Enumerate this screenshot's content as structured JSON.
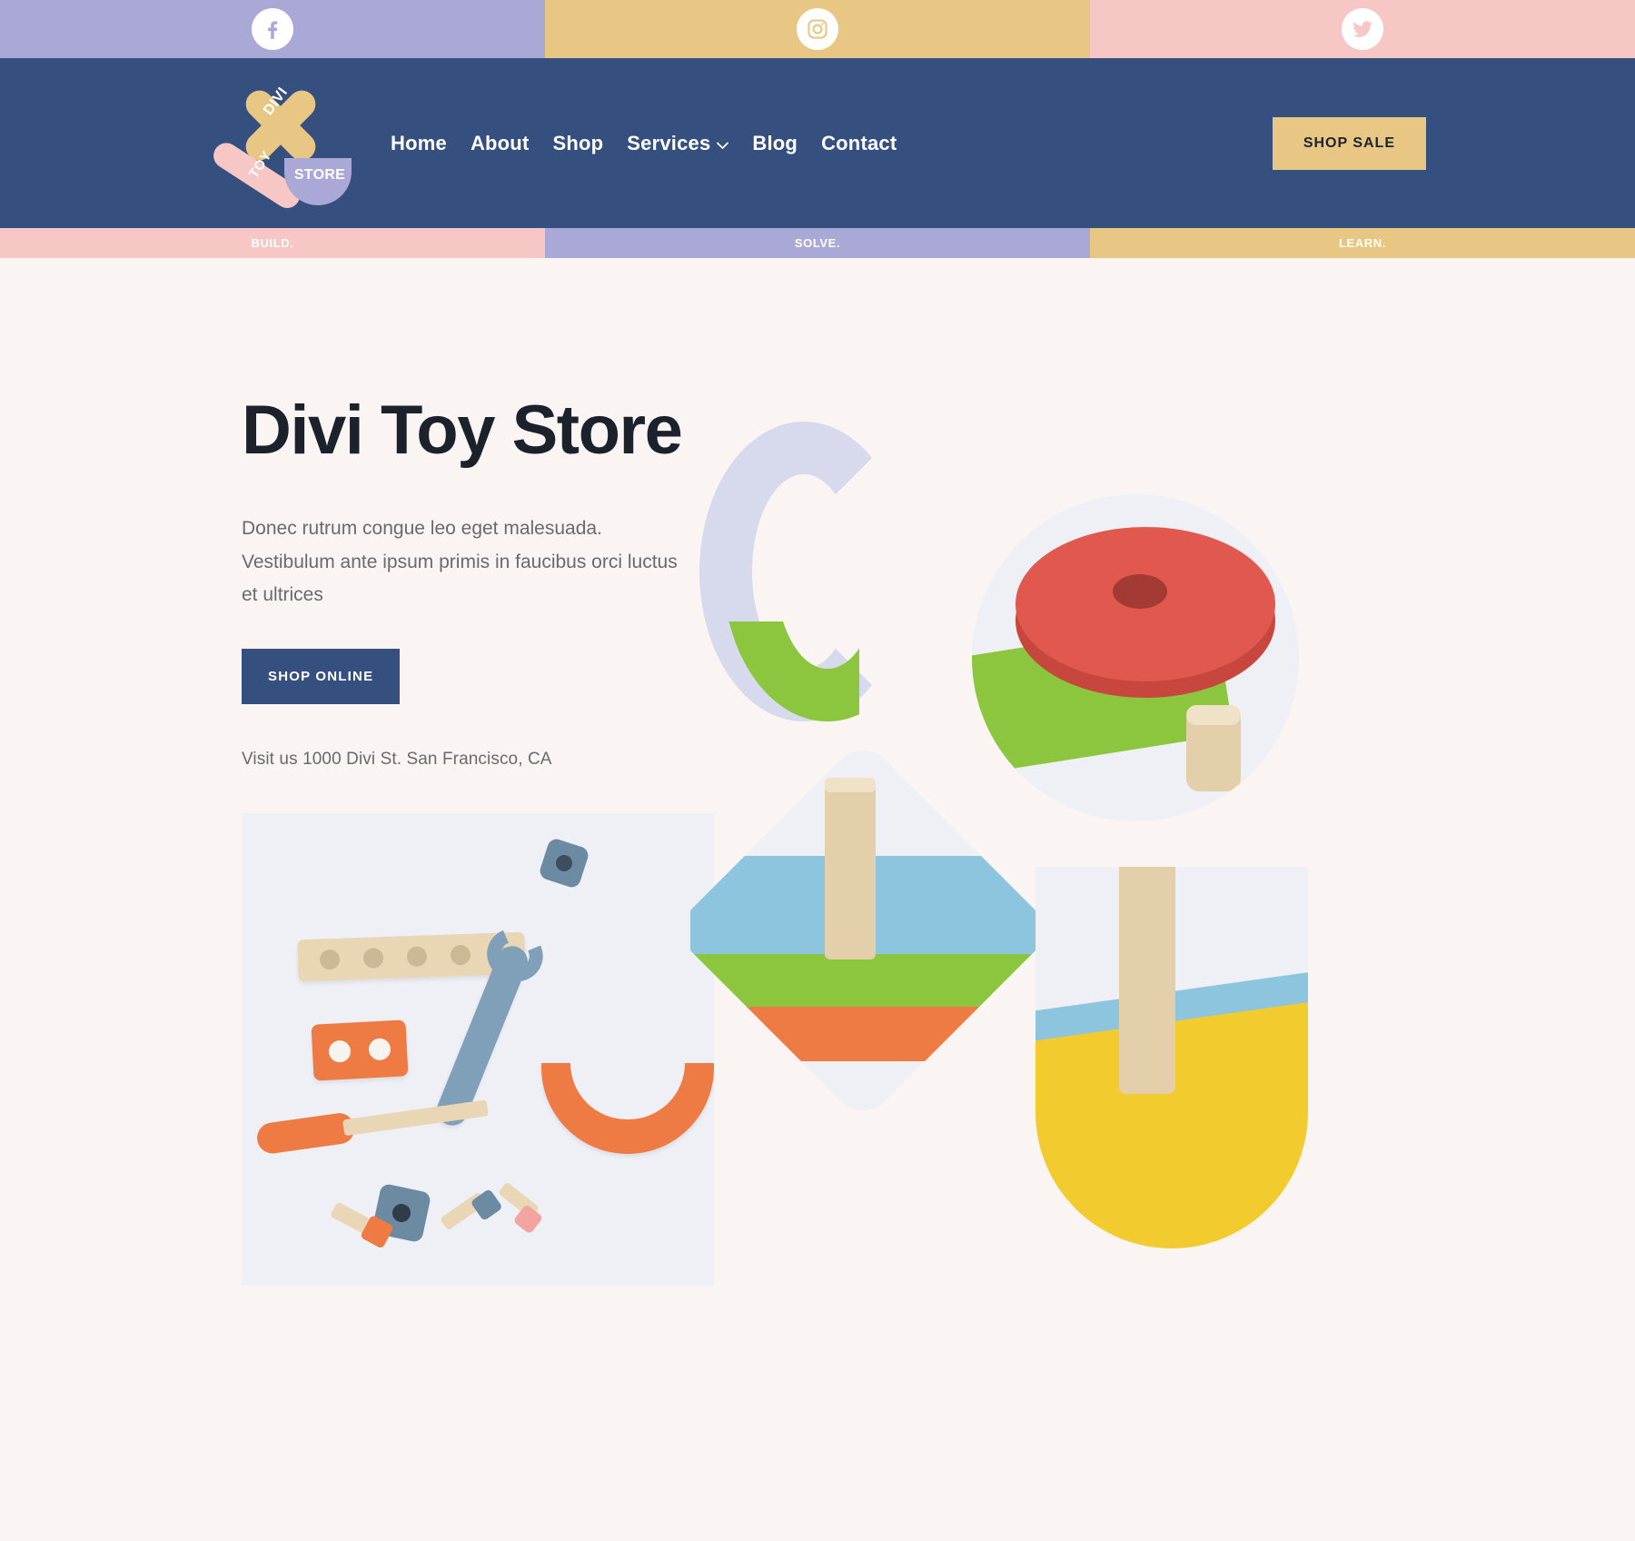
{
  "social_bar": {
    "items": [
      {
        "name": "facebook",
        "icon": "facebook-icon",
        "bg": "#a9a8d6",
        "glyph_color": "#a9a8d6"
      },
      {
        "name": "instagram",
        "icon": "instagram-icon",
        "bg": "#e8c683",
        "glyph_color": "#e8c683"
      },
      {
        "name": "twitter",
        "icon": "twitter-icon",
        "bg": "#f6c7c4",
        "glyph_color": "#f6c7c4"
      }
    ]
  },
  "navbar": {
    "bg": "#35507f",
    "logo": {
      "divi": "DIVI",
      "toy": "TOY",
      "store": "STORE"
    },
    "menu": [
      {
        "label": "Home",
        "has_dropdown": false
      },
      {
        "label": "About",
        "has_dropdown": false
      },
      {
        "label": "Shop",
        "has_dropdown": false
      },
      {
        "label": "Services",
        "has_dropdown": true
      },
      {
        "label": "Blog",
        "has_dropdown": false
      },
      {
        "label": "Contact",
        "has_dropdown": false
      }
    ],
    "cta": {
      "label": "SHOP SALE",
      "bg": "#e8c683",
      "color": "#1c2430"
    }
  },
  "strap": {
    "cells": [
      {
        "label": "BUILD.",
        "bg": "#f6c7c4"
      },
      {
        "label": "SOLVE.",
        "bg": "#a9a8d6"
      },
      {
        "label": "LEARN.",
        "bg": "#e8c683"
      }
    ]
  },
  "hero": {
    "title": "Divi Toy Store",
    "paragraph": "Donec rutrum congue leo eget malesuada. Vestibulum ante ipsum primis in faucibus orci luctus et ultrices",
    "cta": {
      "label": "SHOP ONLINE",
      "bg": "#35507f",
      "color": "#ffffff"
    },
    "address": "Visit us 1000 Divi St. San Francisco, CA",
    "image_alt_tools": "wooden toy tools flat lay photo",
    "image_alt_collage": "wooden stacking toys collage"
  },
  "theme": {
    "page_bg": "#faf5f2",
    "navy": "#35507f",
    "tan": "#e8c683",
    "pink": "#f6c7c4",
    "periwinkle": "#a9a8d6",
    "heading": "#1b222c",
    "body_text": "#6a6a6a"
  }
}
